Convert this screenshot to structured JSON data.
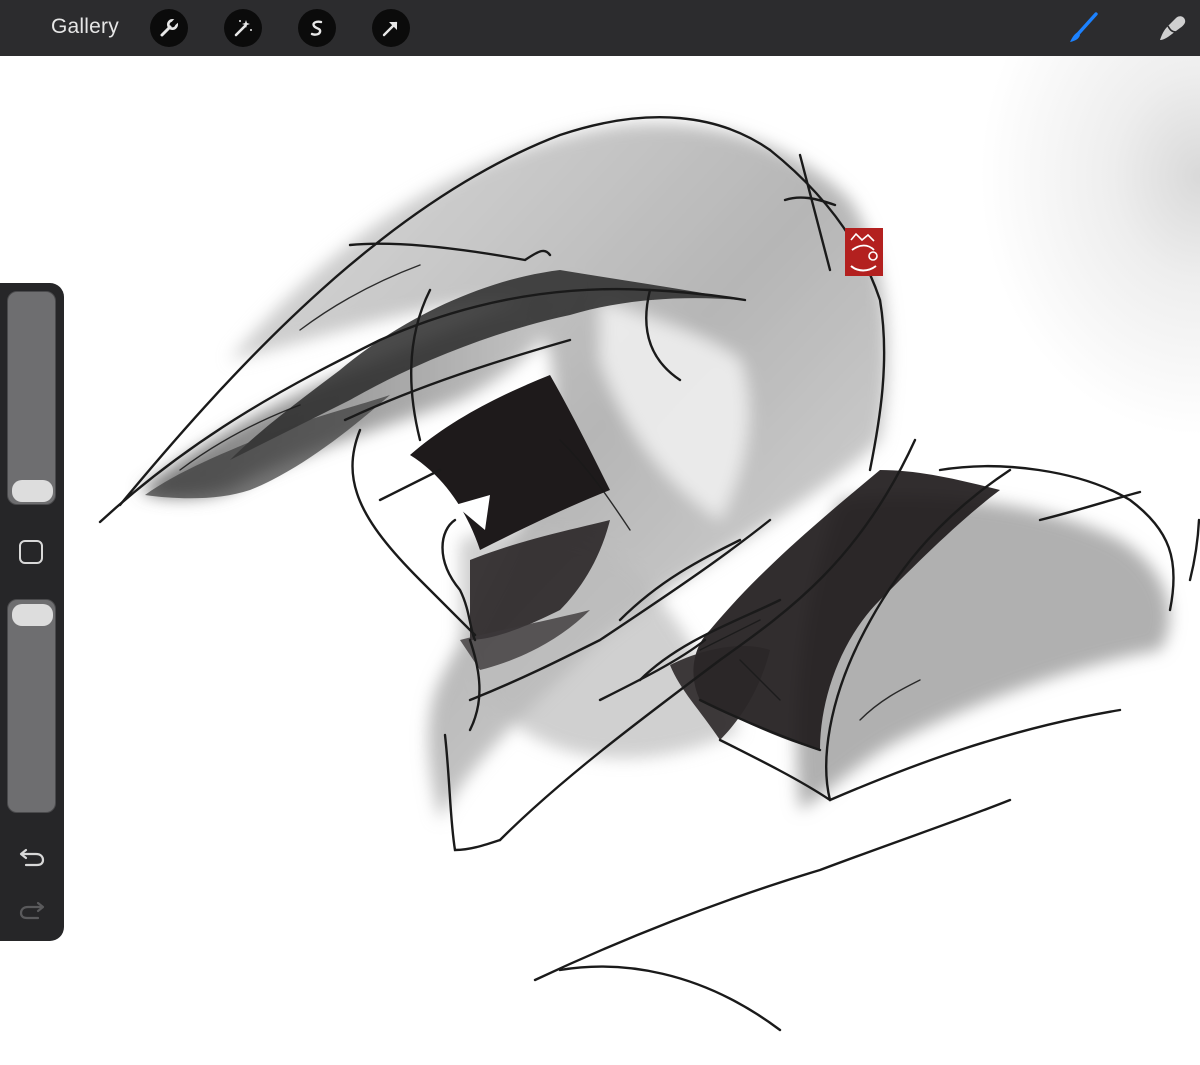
{
  "toolbar": {
    "gallery_label": "Gallery",
    "tools": [
      {
        "icon": "wrench-icon",
        "name": "actions"
      },
      {
        "icon": "magic-wand-icon",
        "name": "adjustments"
      },
      {
        "icon": "selection-s-icon",
        "name": "selection"
      },
      {
        "icon": "arrow-cursor-icon",
        "name": "transform"
      }
    ],
    "right_tools": [
      {
        "icon": "brush-icon",
        "name": "paint",
        "active": true,
        "color": "#1c82ff"
      },
      {
        "icon": "smudge-icon",
        "name": "smudge",
        "active": false
      }
    ]
  },
  "sidebar": {
    "brush_size_level": 0.05,
    "opacity_level": 1.0,
    "buttons": [
      {
        "icon": "modify-square-icon"
      },
      {
        "icon": "undo-icon"
      },
      {
        "icon": "redo-icon"
      }
    ]
  },
  "artwork": {
    "subject": "helmet-sketch",
    "signature_stamp_color": "#b3201f"
  }
}
